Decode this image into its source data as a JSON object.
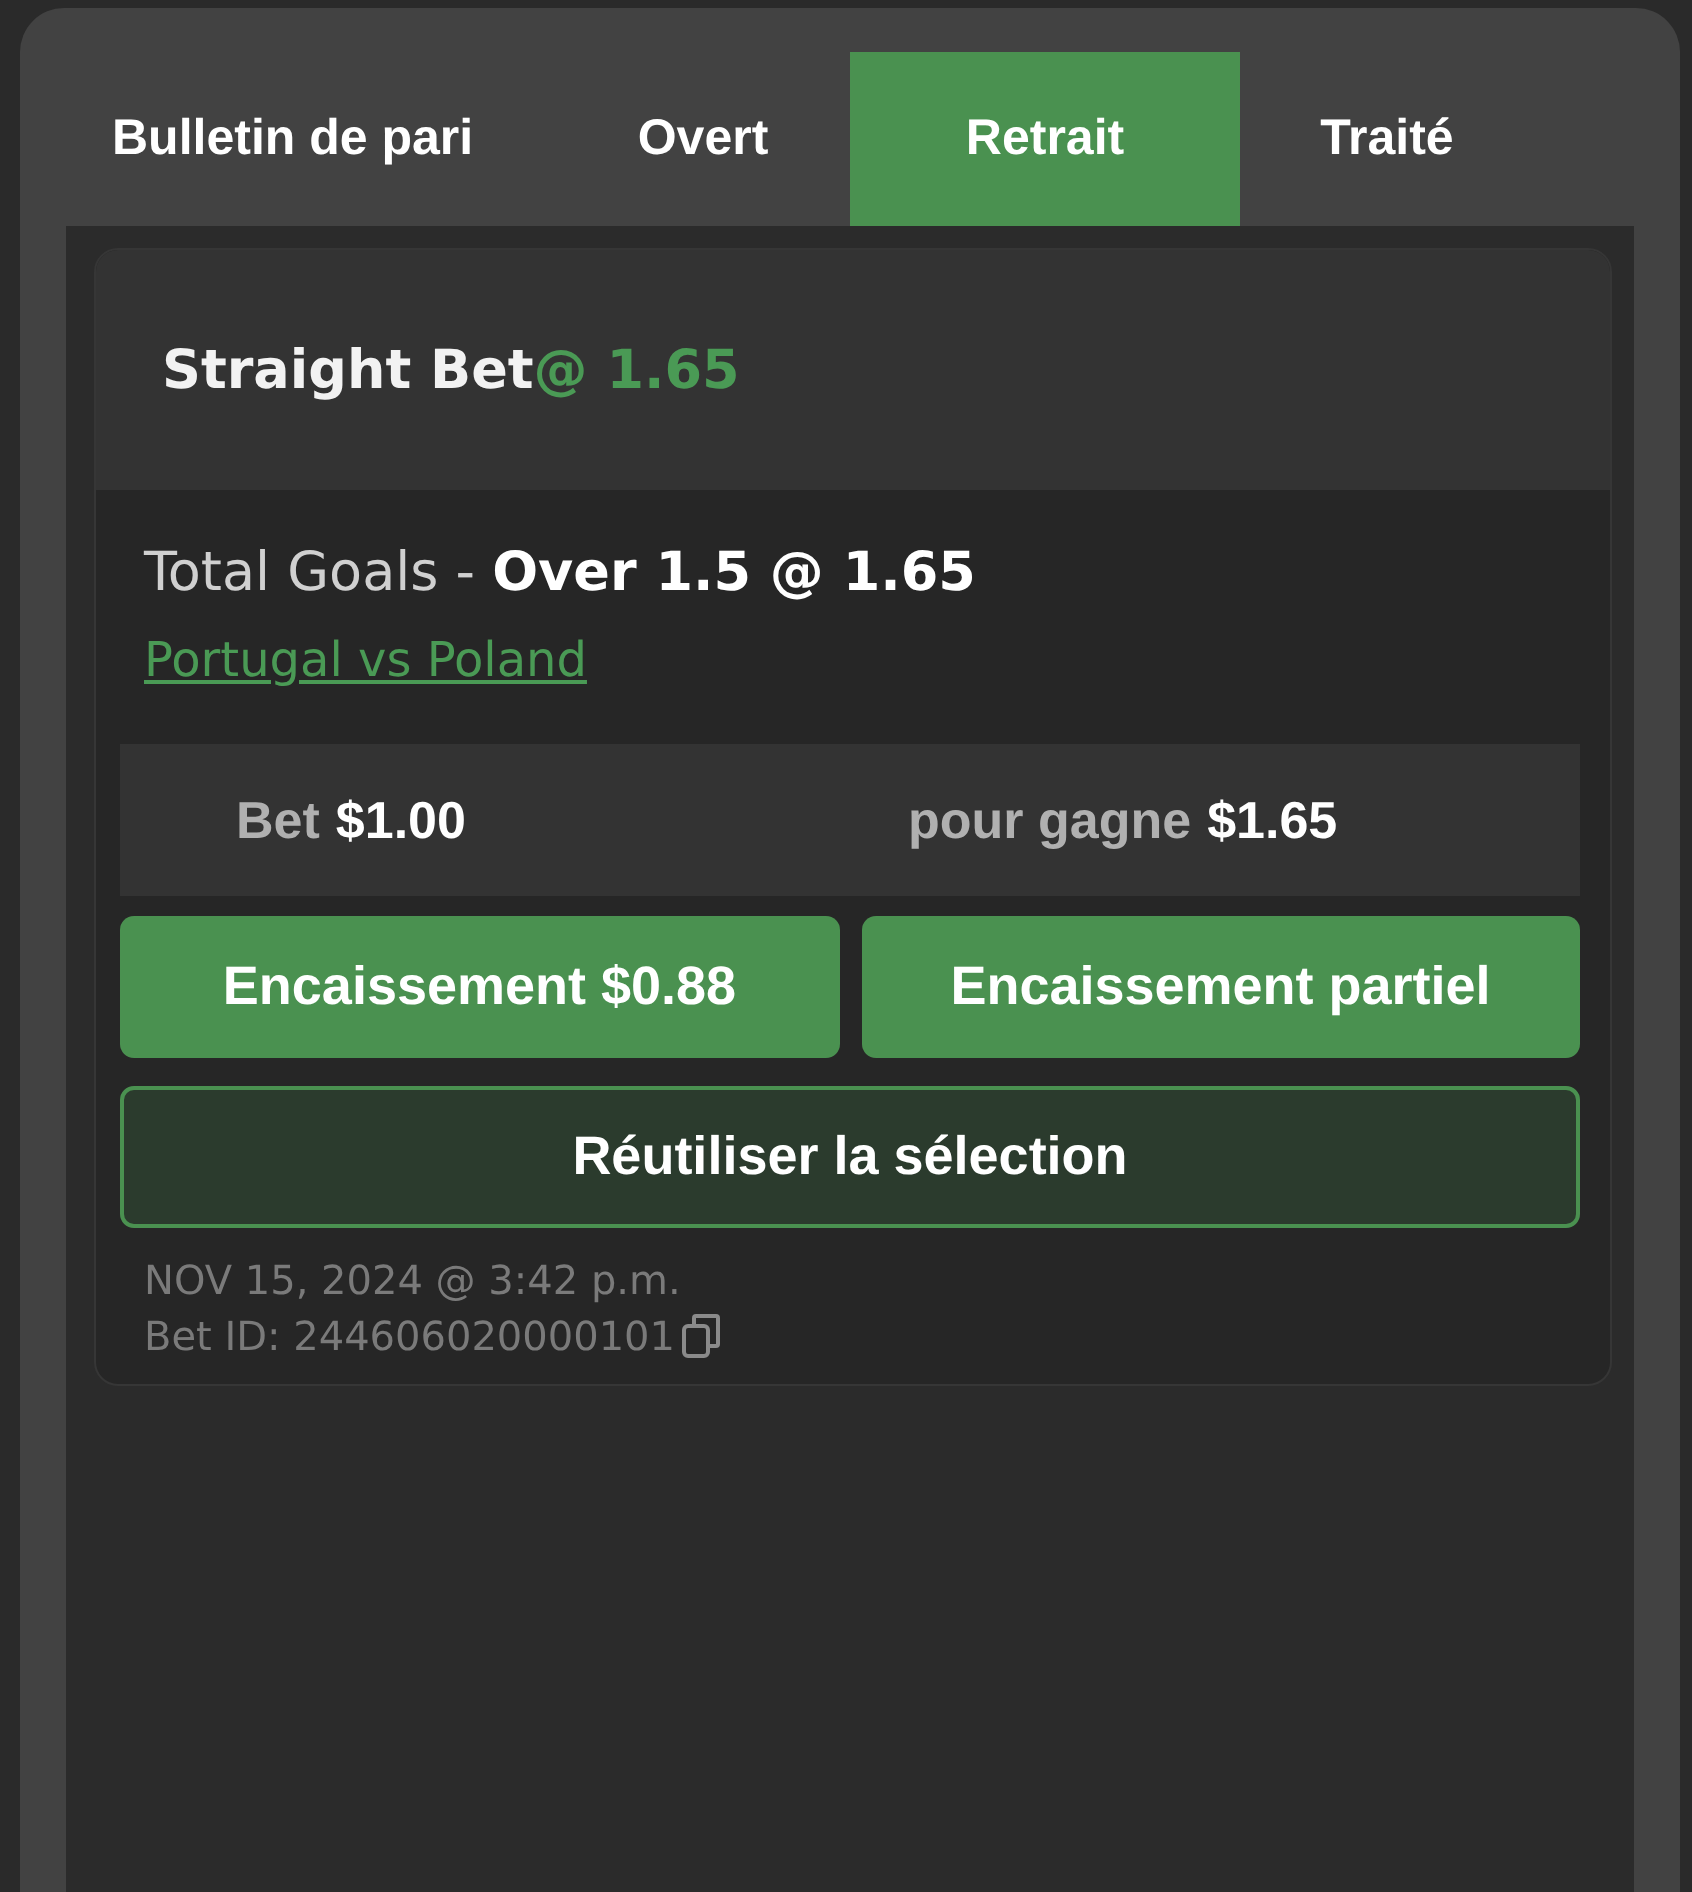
{
  "tabs": [
    {
      "label": "Bulletin de pari",
      "selected": false
    },
    {
      "label": "Overt",
      "selected": false
    },
    {
      "label": "Retrait",
      "selected": true
    },
    {
      "label": "Traité",
      "selected": false
    }
  ],
  "bet": {
    "title": "Straight Bet",
    "odds": "@ 1.65",
    "selection": "Total Goals - **Over 1.5 @ 1.65**",
    "match": "Portugal vs Poland",
    "stake_label": "Bet",
    "stake": "$1.00",
    "win_label": "pour gagne",
    "win": "$1.65",
    "buttons": [
      {
        "label": "Encaissement $0.88",
        "kind": "primary"
      },
      {
        "label": "Encaissement partiel",
        "kind": "primary"
      },
      {
        "label": "Réutiliser la sélection",
        "kind": "outline"
      }
    ],
    "date": "NOV 15, 2024 @ 3:42 p.m.",
    "bet_id": "Bet ID: 244606020000101"
  }
}
